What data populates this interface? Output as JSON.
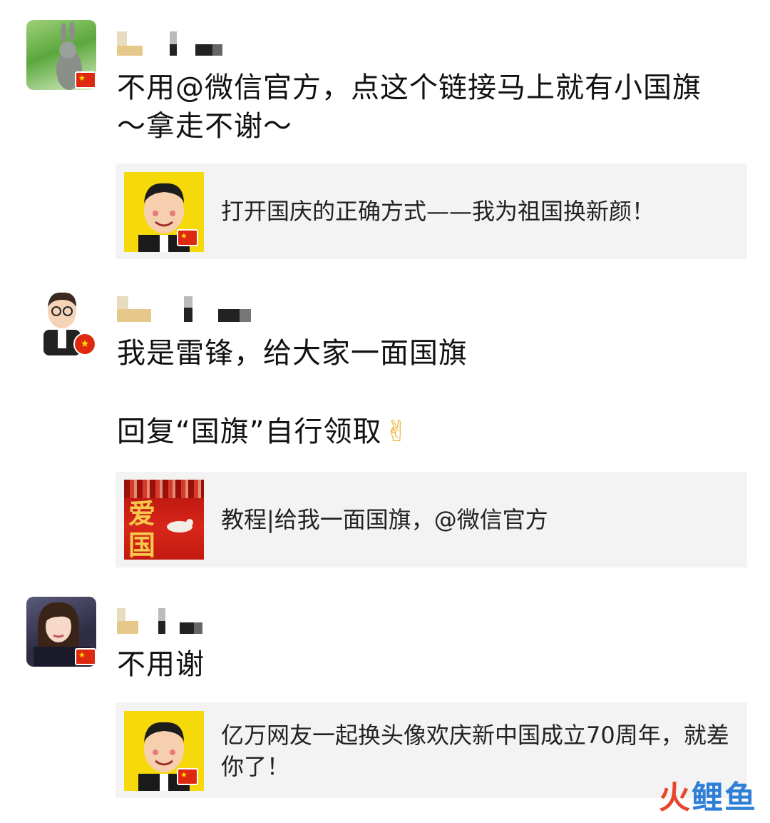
{
  "posts": [
    {
      "avatar": "rabbit-avatar",
      "text": "不用@微信官方，点这个链接马上就有小国旗～拿走不谢～",
      "card": {
        "title": "打开国庆的正确方式——我为祖国换新颜！",
        "thumb": "cartoon-man-thumbnail"
      }
    },
    {
      "avatar": "cartoon-man-avatar",
      "text_line1": "我是雷锋，给大家一面国旗",
      "text_line2": "回复“国旗”自行领取",
      "emoji": "✌",
      "card": {
        "title": "教程|给我一面国旗，@微信官方",
        "thumb": "ai-guo-poster-thumbnail",
        "thumb_text": "爱国"
      }
    },
    {
      "avatar": "woman-avatar",
      "text": "不用谢",
      "card": {
        "title": "亿万网友一起换头像欢庆新中国成立70周年，就差你了！",
        "thumb": "cartoon-man-thumbnail"
      }
    }
  ],
  "flag_glyph": "★",
  "watermark": {
    "left": "火",
    "right": "鲤鱼"
  },
  "colors": {
    "flag_red": "#de2910",
    "flag_yellow": "#ffde00",
    "card_bg": "#f3f3f3",
    "watermark_red": "#e8452c",
    "watermark_blue": "#2f7ed8"
  }
}
